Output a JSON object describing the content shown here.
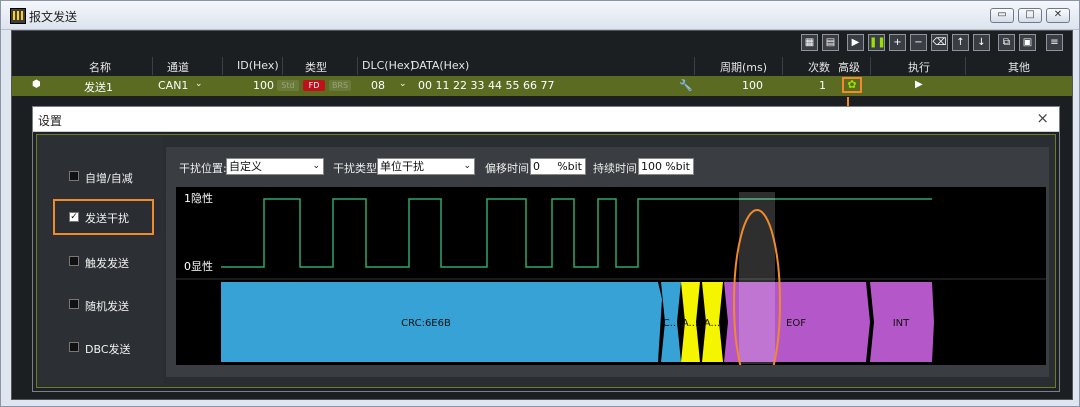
{
  "window": {
    "title": "报文发送",
    "min_icon": "minimize-icon",
    "max_icon": "maximize-icon",
    "close_icon": "close-icon"
  },
  "toolbar": {
    "icons": [
      "export-icon",
      "import-icon",
      "play-icon",
      "pause-icon",
      "add-icon",
      "delete-icon",
      "clear-icon",
      "up-icon",
      "down-icon",
      "copy-icon",
      "paste-icon",
      "menu-icon"
    ]
  },
  "columns": {
    "name": "名称",
    "channel": "通道",
    "id": "ID(Hex)",
    "type": "类型",
    "dlc": "DLC(Hex)",
    "data": "DATA(Hex)",
    "period": "周期(ms)",
    "count": "次数",
    "advanced": "高级",
    "execute": "执行",
    "other": "其他"
  },
  "row": {
    "name": "发送1",
    "channel": "CAN1",
    "id": "100",
    "type_std": "Std",
    "type_fd": "FD",
    "type_brs": "BRS",
    "dlc": "08",
    "data": "00 11 22 33 44 55 66 77",
    "period": "100",
    "count": "1"
  },
  "settings": {
    "title": "设置",
    "close": "×",
    "side_items": [
      {
        "label": "自增/自减",
        "checked": false
      },
      {
        "label": "发送干扰",
        "checked": true
      },
      {
        "label": "触发发送",
        "checked": false
      },
      {
        "label": "随机发送",
        "checked": false
      },
      {
        "label": "DBC发送",
        "checked": false
      }
    ],
    "controls": {
      "pos_label": "干扰位置:",
      "pos_value": "自定义",
      "type_label": "干扰类型:",
      "type_value": "单位干扰",
      "offset_label": "偏移时间:",
      "offset_value": "0",
      "offset_unit": "%bit",
      "duration_label": "持续时间:",
      "duration_value": "100",
      "duration_unit": "%bit"
    },
    "chart_labels": {
      "high": "1隐性",
      "low": "0显性"
    },
    "segments": [
      {
        "label": "CRC:6E6B",
        "color": "#36a2d6"
      },
      {
        "label": "C...",
        "color": "#36a2d6"
      },
      {
        "label": "A...",
        "color": "#f5f500"
      },
      {
        "label": "A...",
        "color": "#f5f500"
      },
      {
        "label": "EOF",
        "color": "#b457c8"
      },
      {
        "label": "INT",
        "color": "#b457c8"
      }
    ]
  }
}
